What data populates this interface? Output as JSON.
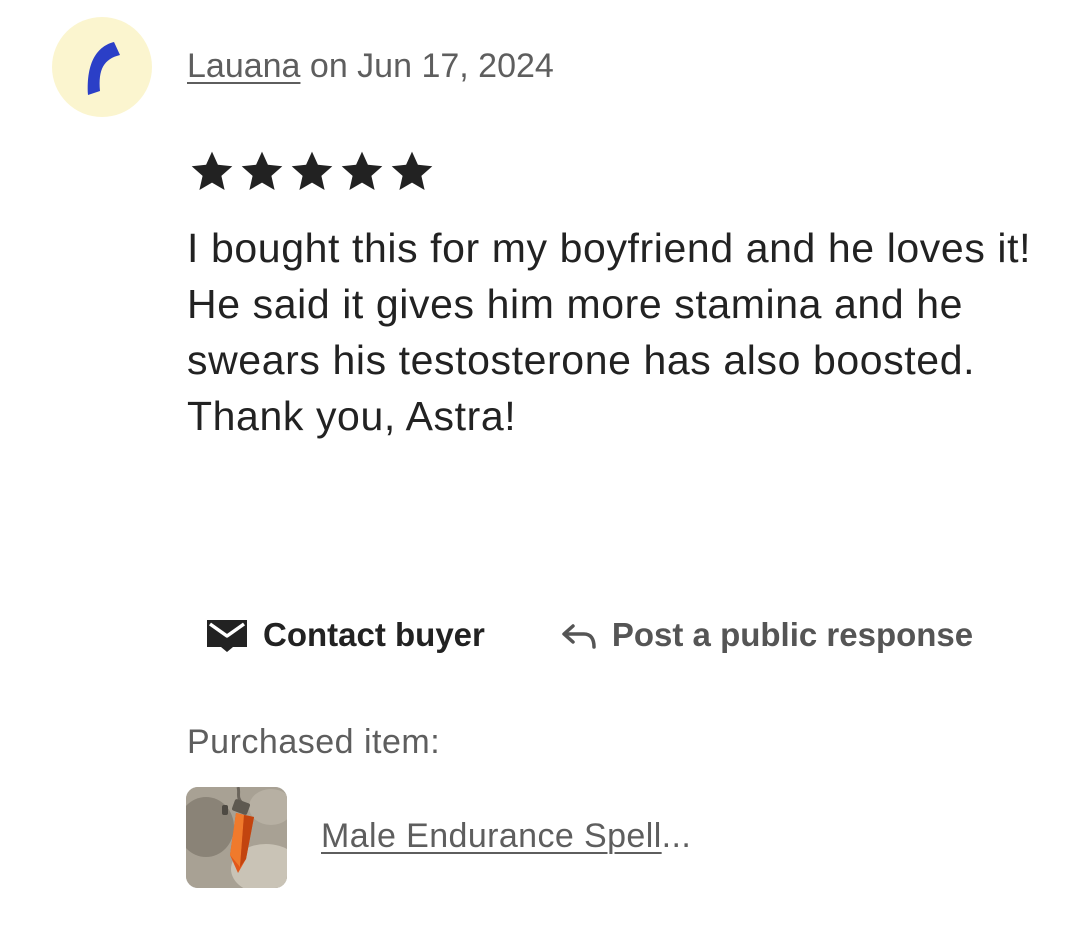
{
  "review": {
    "reviewer_name": "Lauana",
    "date_text": " on Jun 17, 2024",
    "rating": 5,
    "rating_max": 5,
    "text": "I bought this for my boyfriend and he loves it! He said it gives him more stamina and he swears his testosterone has also boosted. Thank you, Astra!"
  },
  "avatar": {
    "icon": "crescent-icon",
    "background_color": "#fbf5cf",
    "icon_color": "#2b3fc7"
  },
  "actions": {
    "contact_label": "Contact buyer",
    "contact_icon": "envelope-icon",
    "post_label": "Post a public response",
    "post_icon": "reply-arrow-icon"
  },
  "purchase": {
    "label": "Purchased item:",
    "item_title": "Male Endurance Spell",
    "item_ellipsis": "...",
    "thumbnail": "orange-crystal-pendant"
  },
  "colors": {
    "star": "#222222",
    "muted_text": "#5e5e5e"
  }
}
